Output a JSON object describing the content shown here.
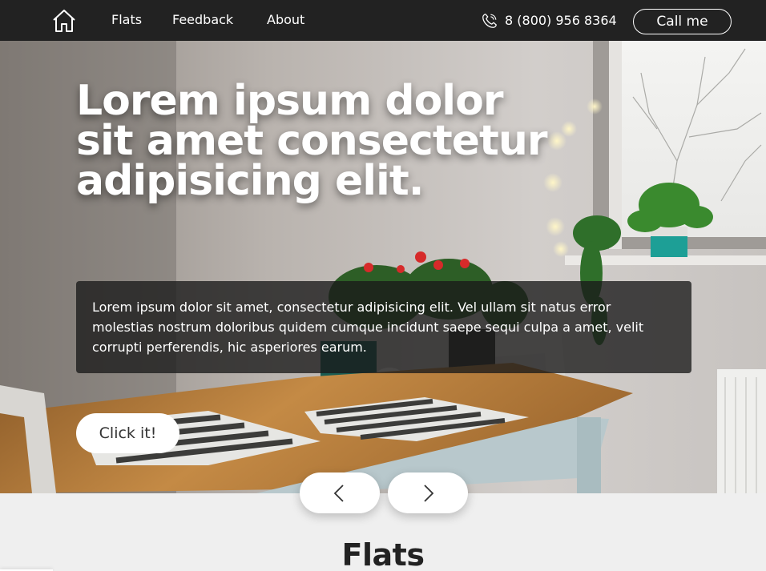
{
  "header": {
    "nav": {
      "flats": "Flats",
      "feedback": "Feedback",
      "about": "About"
    },
    "phone": "8 (800) 956 8364",
    "call_button": "Call me"
  },
  "hero": {
    "title": "Lorem ipsum dolor sit amet consectetur adipisicing elit.",
    "text": "Lorem ipsum dolor sit amet, consectetur adipisicing elit. Vel ullam sit natus error molestias nostrum doloribus quidem cumque incidunt saepe sequi culpa a amet, velit corrupti perferendis, hic asperiores earum.",
    "cta": "Click it!"
  },
  "slider": {
    "prev_icon": "chevron-left-icon",
    "next_icon": "chevron-right-icon"
  },
  "flats_section": {
    "title": "Flats"
  },
  "colors": {
    "header_bg": "#222222",
    "page_bg": "#efefef",
    "text_box_bg": "#191919"
  },
  "icons": {
    "home": "home-icon",
    "phone": "phone-icon"
  }
}
